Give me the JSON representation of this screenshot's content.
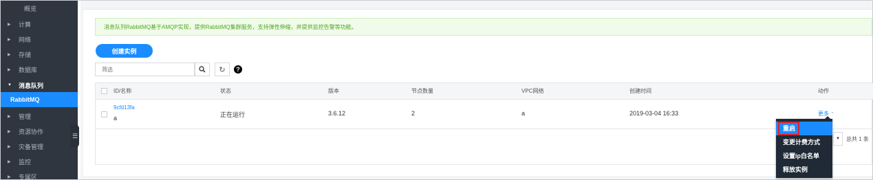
{
  "sidebar": {
    "items": [
      {
        "label": "概览"
      },
      {
        "label": "计算"
      },
      {
        "label": "网络"
      },
      {
        "label": "存储"
      },
      {
        "label": "数据库"
      },
      {
        "label": "消息队列"
      },
      {
        "label": "RabbitMQ"
      },
      {
        "label": "管理"
      },
      {
        "label": "资源协作"
      },
      {
        "label": "灾备管理"
      },
      {
        "label": "监控"
      },
      {
        "label": "专属区"
      }
    ]
  },
  "notice": "消息队列RabbitMQ基于AMQP实现，提供RabbitMQ集群服务，支持弹性伸缩，并提供监控告警等功能。",
  "toolbar": {
    "create_label": "创建实例",
    "search_placeholder": "筛选"
  },
  "table": {
    "headers": [
      "ID/名称",
      "状态",
      "版本",
      "节点数量",
      "VPC网络",
      "创建时间",
      "动作"
    ],
    "rows": [
      {
        "id": "9cfd13fa",
        "name": "a",
        "status": "正在运行",
        "version": "3.6.12",
        "nodes": "2",
        "vpc": "a",
        "created": "2019-03-04 16:33",
        "action": "更多"
      }
    ]
  },
  "menu": {
    "items": [
      "重启",
      "变更计费方式",
      "设置ip白名单",
      "释放实例"
    ]
  },
  "pagination": {
    "total": "总共 1 条"
  },
  "colors": {
    "accent": "#1a8cff",
    "sidebar_bg": "#2f3640",
    "notice_text": "#52a625",
    "highlight": "#e0202a"
  }
}
